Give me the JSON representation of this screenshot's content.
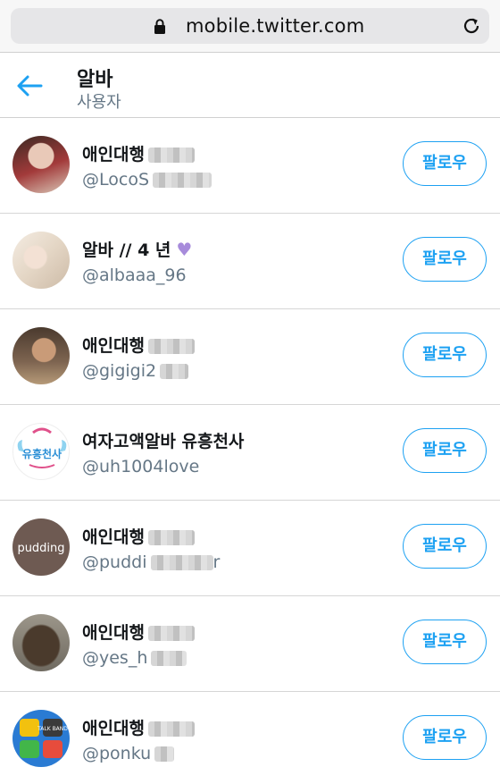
{
  "browser": {
    "url": "mobile.twitter.com"
  },
  "header": {
    "title": "알바",
    "subtitle": "사용자"
  },
  "users": [
    {
      "name": "애인대행",
      "handle": "@LocoS",
      "follow_label": "팔로우",
      "avatar_color": "#a23a3a"
    },
    {
      "name": "알바 // 4 년",
      "handle": "@albaaa_96",
      "follow_label": "팔로우",
      "avatar_color": "#e7dccf"
    },
    {
      "name": "애인대행",
      "handle": "@gigigi2",
      "follow_label": "팔로우",
      "avatar_color": "#5b4433"
    },
    {
      "name": "여자고액알바 유흥천사",
      "handle": "@uh1004love",
      "follow_label": "팔로우",
      "avatar_text": "유흥천사",
      "avatar_color": "#3a9ad9"
    },
    {
      "name": "애인대행",
      "handle": "@puddi",
      "handle_tail": "r",
      "follow_label": "팔로우",
      "avatar_text": "pudding",
      "avatar_color": "#6e5a52"
    },
    {
      "name": "애인대행",
      "handle": "@yes_h",
      "follow_label": "팔로우",
      "avatar_color": "#3f3b35"
    },
    {
      "name": "애인대행",
      "handle": "@ponku",
      "follow_label": "팔로우",
      "avatar_text": "TALK BAND",
      "avatar_color": "#2a7bd3"
    }
  ]
}
